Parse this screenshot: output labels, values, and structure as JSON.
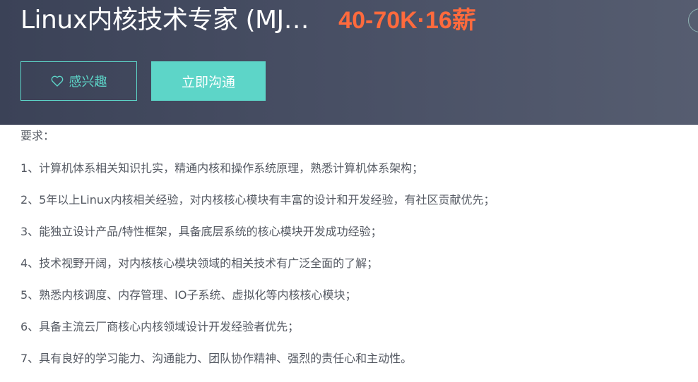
{
  "header": {
    "job_title": "Linux内核技术专家 (MJ…",
    "salary": "40-70K·16薪",
    "interest_button": {
      "icon": "heart-outline-icon",
      "label": "感兴趣"
    },
    "chat_button": {
      "label": "立即沟通"
    },
    "colors": {
      "background": "#454c60",
      "accent": "#5dd5c8",
      "salary": "#ff6a3d"
    }
  },
  "requirements": {
    "heading": "要求：",
    "items": [
      "1、计算机体系相关知识扎实，精通内核和操作系统原理，熟悉计算机体系架构；",
      "2、5年以上Linux内核相关经验，对内核核心模块有丰富的设计和开发经验，有社区贡献优先；",
      "3、能独立设计产品/特性框架，具备底层系统的核心模块开发成功经验；",
      "4、技术视野开阔，对内核核心模块领域的相关技术有广泛全面的了解；",
      "5、熟悉内核调度、内存管理、IO子系统、虚拟化等内核核心模块；",
      "6、具备主流云厂商核心内核领域设计开发经验者优先；",
      "7、具有良好的学习能力、沟通能力、团队协作精神、强烈的责任心和主动性。"
    ]
  }
}
